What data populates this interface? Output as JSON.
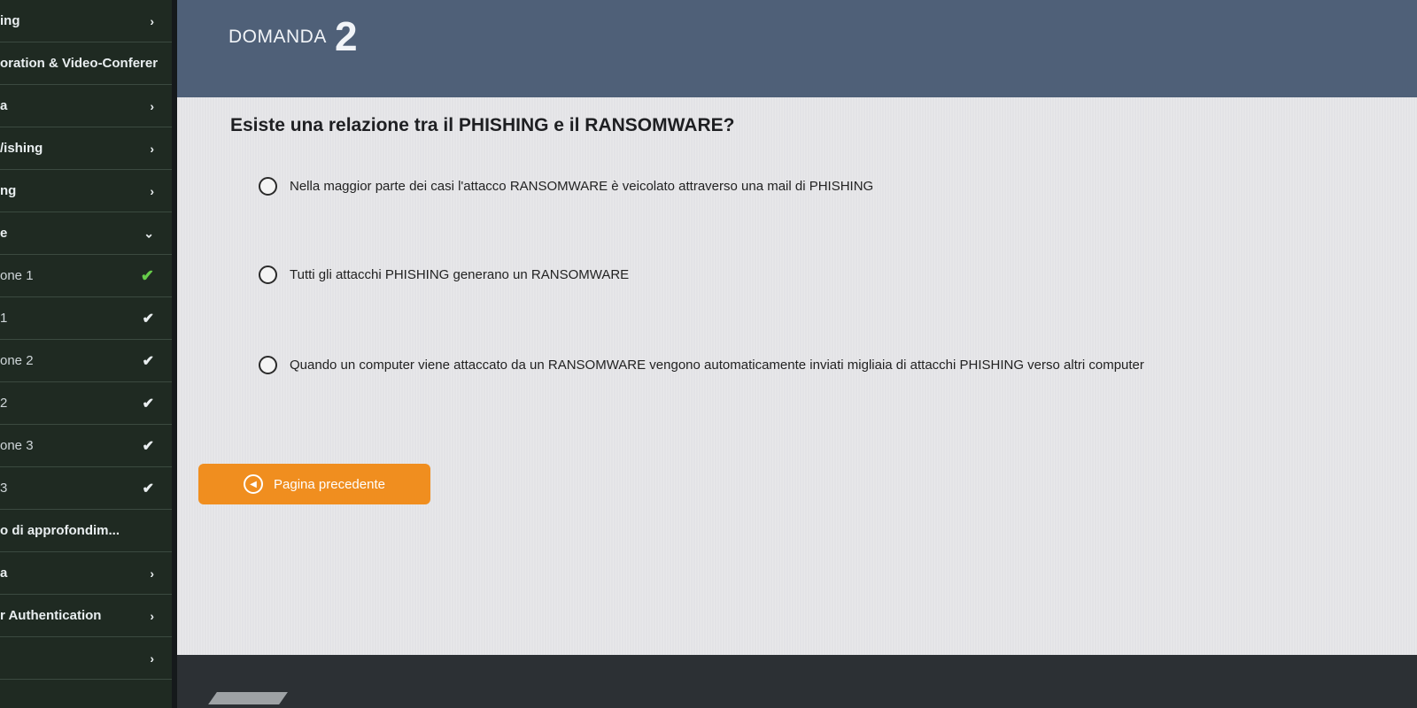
{
  "sidebar": {
    "items": [
      {
        "label": "ing",
        "trail": "›",
        "trail_kind": "chevron",
        "style": "bold"
      },
      {
        "label": "oration & Video-Conferer",
        "trail": "",
        "trail_kind": "none",
        "style": "bold"
      },
      {
        "label": "a",
        "trail": "›",
        "trail_kind": "chevron",
        "style": "bold"
      },
      {
        "label": "/ishing",
        "trail": "›",
        "trail_kind": "chevron",
        "style": "bold"
      },
      {
        "label": "ng",
        "trail": "›",
        "trail_kind": "chevron",
        "style": "bold"
      },
      {
        "label": "e",
        "trail": "⌄",
        "trail_kind": "chevron-down",
        "style": "bold"
      },
      {
        "label": "one 1",
        "trail": "✔",
        "trail_kind": "check-green",
        "style": "light"
      },
      {
        "label": "1",
        "trail": "✔",
        "trail_kind": "check",
        "style": "light"
      },
      {
        "label": "one 2",
        "trail": "✔",
        "trail_kind": "check",
        "style": "light"
      },
      {
        "label": "2",
        "trail": "✔",
        "trail_kind": "check",
        "style": "light"
      },
      {
        "label": "one 3",
        "trail": "✔",
        "trail_kind": "check",
        "style": "light"
      },
      {
        "label": "3",
        "trail": "✔",
        "trail_kind": "check",
        "style": "light"
      },
      {
        "label": "o di approfondim...",
        "trail": "",
        "trail_kind": "none",
        "style": "bold"
      },
      {
        "label": "a",
        "trail": "›",
        "trail_kind": "chevron",
        "style": "bold"
      },
      {
        "label": "r Authentication",
        "trail": "›",
        "trail_kind": "chevron",
        "style": "bold"
      },
      {
        "label": "",
        "trail": "›",
        "trail_kind": "chevron",
        "style": "bold"
      }
    ]
  },
  "header": {
    "label": "DOMANDA",
    "number": "2"
  },
  "question": {
    "text": "Esiste una relazione tra il PHISHING e il RANSOMWARE?",
    "options": [
      {
        "text": "Nella maggior parte dei casi l'attacco RANSOMWARE è veicolato attraverso una mail di PHISHING"
      },
      {
        "text": "Tutti gli attacchi PHISHING generano un RANSOMWARE"
      },
      {
        "text": "Quando un computer viene attaccato da un RANSOMWARE vengono automaticamente inviati migliaia di attacchi PHISHING verso altri computer"
      }
    ]
  },
  "navigation": {
    "prev_label": "Pagina precedente",
    "prev_icon": "circle-left-icon"
  },
  "colors": {
    "header": "#4f6078",
    "accent": "#f08e1f",
    "check_green": "#66cc4a"
  }
}
